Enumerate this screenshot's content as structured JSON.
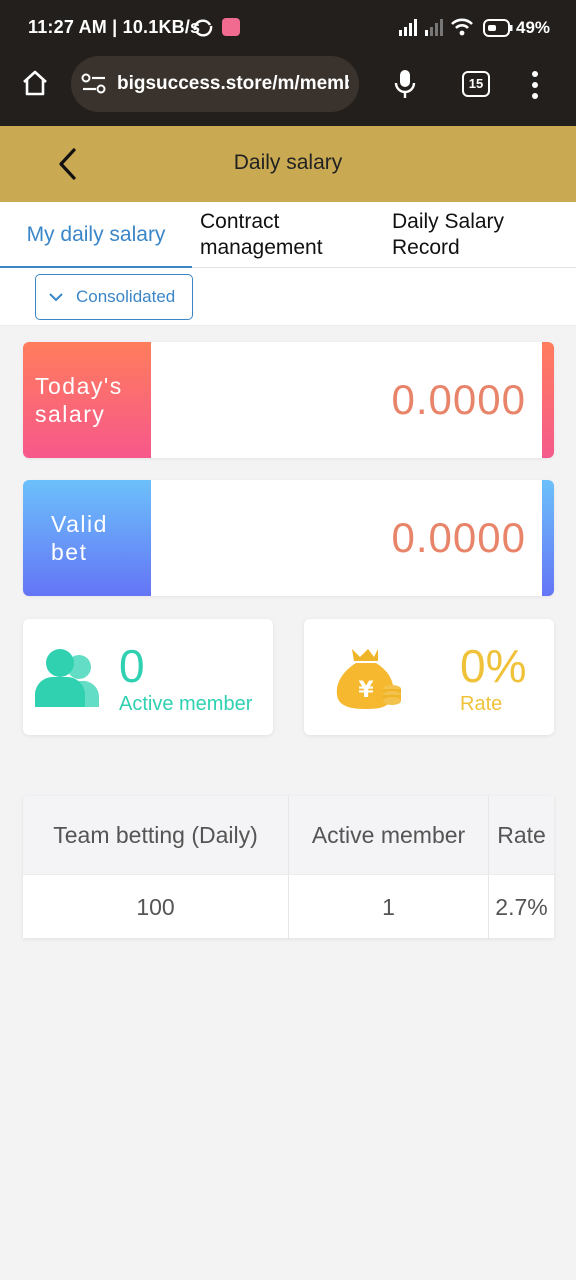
{
  "status_bar": {
    "time": "11:27 AM | 10.1KB/s",
    "battery": "49%",
    "icons": [
      "sync-icon",
      "app-notification-icon",
      "signal-icon",
      "signal-icon",
      "wifi-icon",
      "battery-icon"
    ]
  },
  "browser": {
    "url": "bigsuccess.store/m/member",
    "tab_count": "15",
    "icons": [
      "home-icon",
      "site-settings-icon",
      "mic-icon",
      "tabs-icon",
      "more-vert-icon"
    ]
  },
  "header": {
    "title": "Daily salary",
    "back_icon": "chevron-left-icon",
    "bg_color": "#c9aa52"
  },
  "tabs": [
    {
      "label": "My daily salary",
      "active": true
    },
    {
      "label": "Contract management",
      "active": false
    },
    {
      "label": "Daily Salary Record",
      "active": false
    }
  ],
  "filter": {
    "label": "Consolidated",
    "icon": "chevron-down-icon"
  },
  "stats": {
    "salary": {
      "label": "Today's salary",
      "value": "0.0000"
    },
    "valid_bet": {
      "label": "Valid bet",
      "value": "0.0000"
    }
  },
  "summary": {
    "active_member": {
      "value": "0",
      "label": "Active member",
      "icon": "users-icon"
    },
    "rate": {
      "value": "0%",
      "label": "Rate",
      "icon": "money-bag-icon"
    }
  },
  "rate_table": {
    "headers": [
      "Team betting (Daily)",
      "Active member",
      "Rate"
    ],
    "rows": [
      [
        "100",
        "1",
        "2.7%"
      ]
    ]
  },
  "colors": {
    "accent_blue": "#3b86c7",
    "teal": "#2fd1b1",
    "gold": "#f0c23a",
    "value_orange": "#e8846a"
  }
}
